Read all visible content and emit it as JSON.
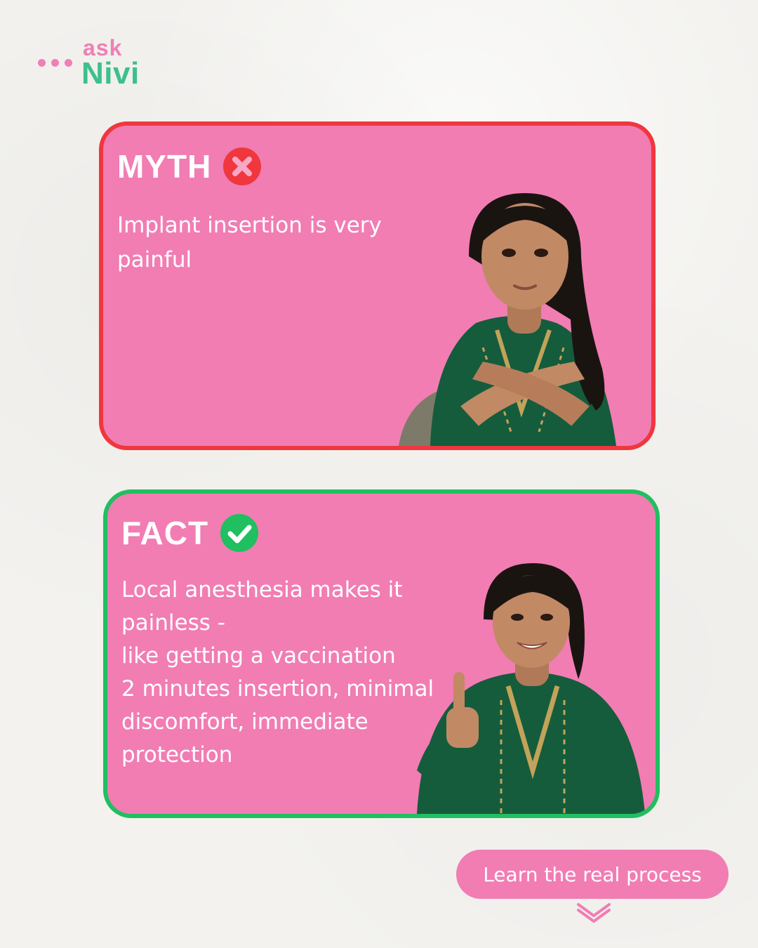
{
  "brand": {
    "top": "ask",
    "bottom": "Nivi",
    "colors": {
      "pink": "#ef7fb4",
      "green": "#3cc08c"
    }
  },
  "myth": {
    "title": "MYTH",
    "icon": "cross-circle-icon",
    "text": "Implant insertion is very painful",
    "border_color": "#f0373e"
  },
  "fact": {
    "title": "FACT",
    "icon": "check-circle-icon",
    "lines": [
      "Local anesthesia makes it painless -",
      "like getting a vaccination",
      "2 minutes insertion, minimal discomfort, immediate protection"
    ],
    "border_color": "#20bf5f"
  },
  "cta": {
    "label": "Learn the real process",
    "icon": "chevron-down-double-icon"
  },
  "card_background": "#f17db3"
}
